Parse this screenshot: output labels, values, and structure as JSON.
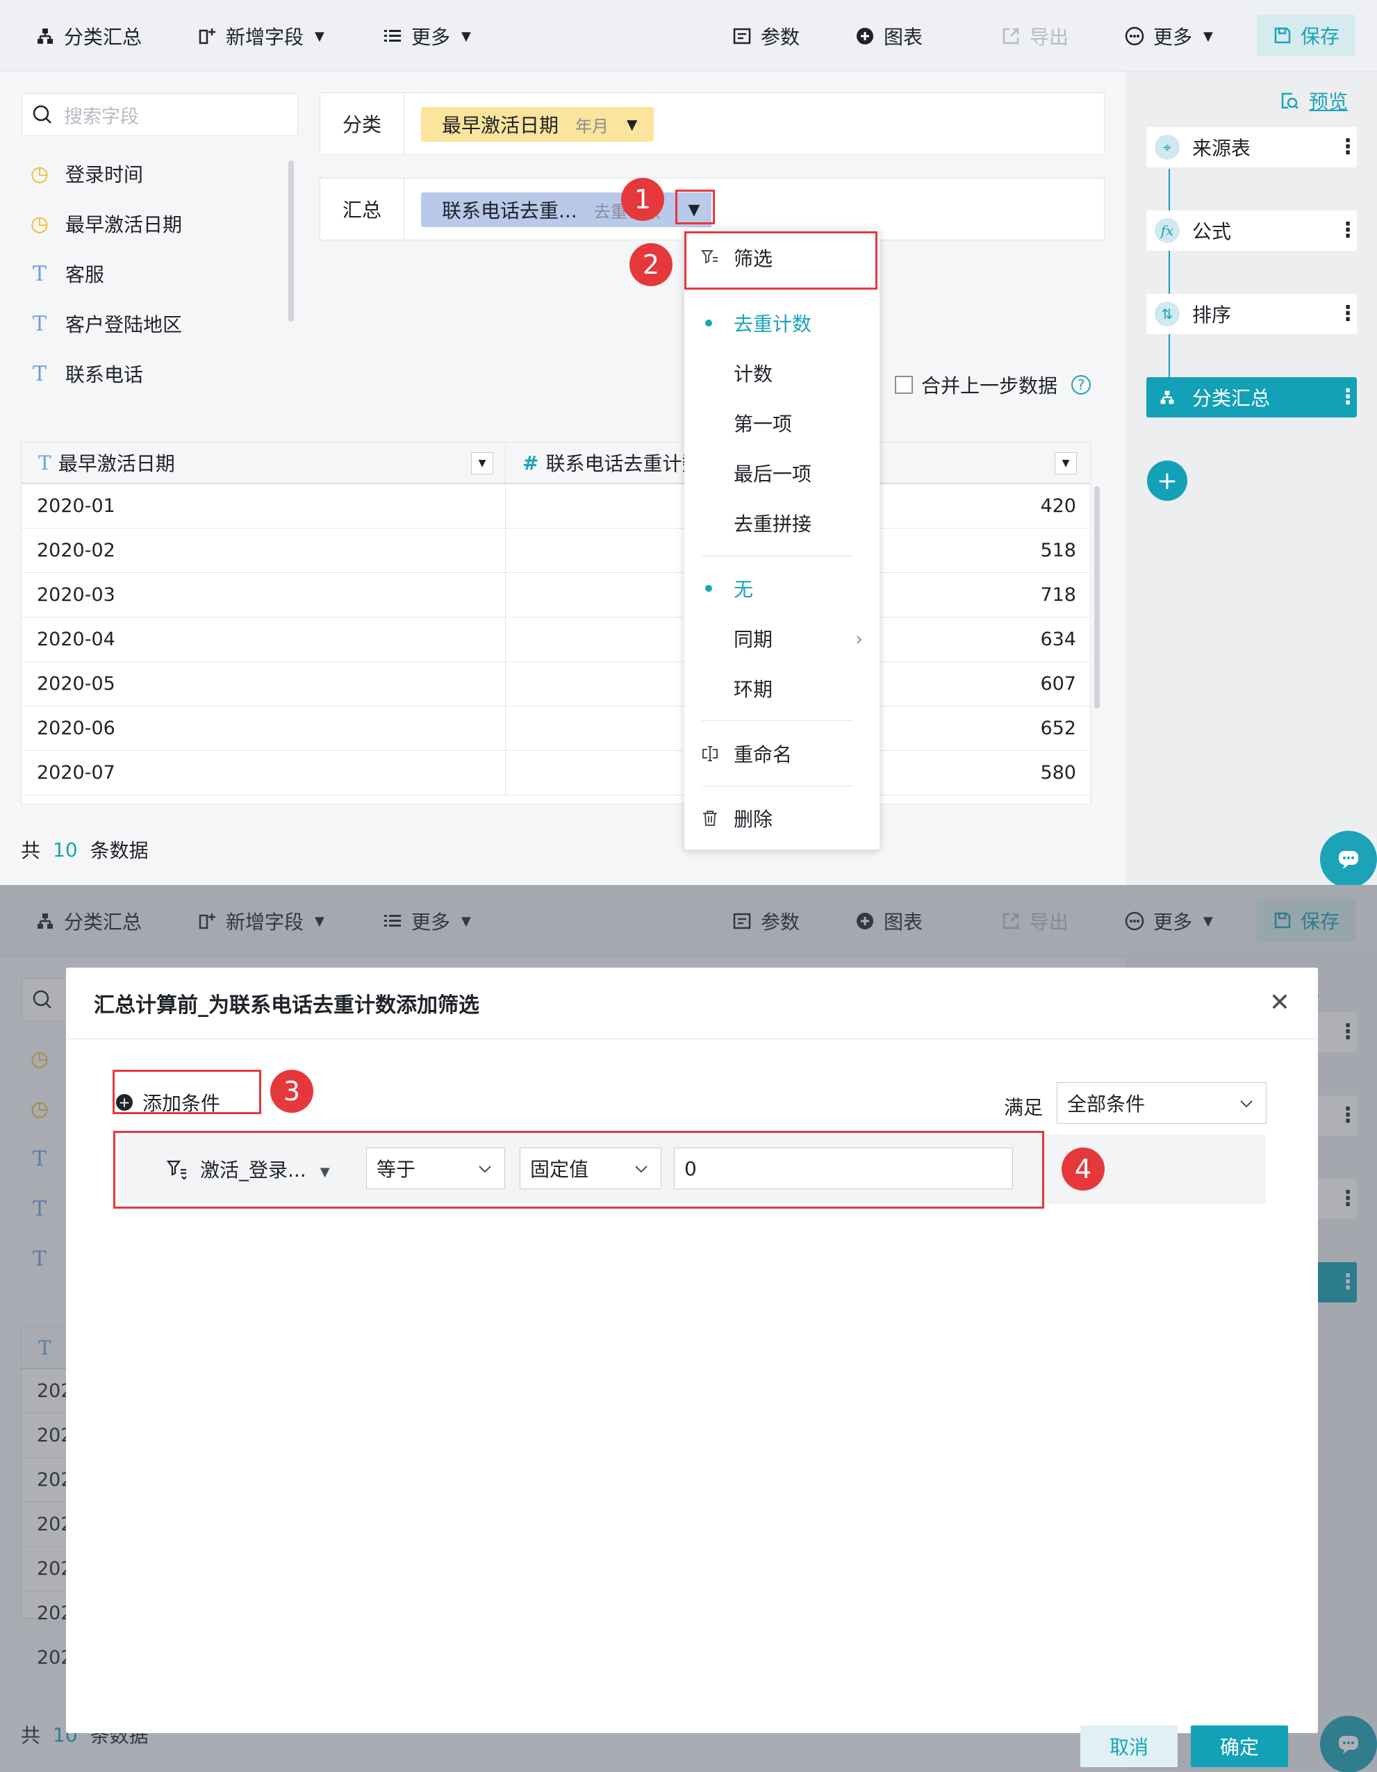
{
  "toolbar": {
    "group_summary": "分类汇总",
    "add_field": "新增字段",
    "more_left": "更多",
    "param": "参数",
    "chart": "图表",
    "export": "导出",
    "more_right": "更多",
    "save": "保存"
  },
  "left_panel": {
    "search_placeholder": "搜索字段",
    "fields": [
      {
        "name": "登录时间",
        "type": "clock-icon"
      },
      {
        "name": "最早激活日期",
        "type": "clock-icon"
      },
      {
        "name": "客服",
        "type": "text-type-icon"
      },
      {
        "name": "客户登陆地区",
        "type": "text-type-icon"
      },
      {
        "name": "联系电话",
        "type": "text-type-icon"
      }
    ]
  },
  "config": {
    "category_label": "分类",
    "category_chip": "最早激活日期",
    "category_sub": "年月",
    "summary_label": "汇总",
    "summary_chip": "联系电话去重...",
    "summary_sub": "去重计数",
    "merge_label": "合并上一步数据"
  },
  "table": {
    "columns": [
      "最早激活日期",
      "联系电话去重计数"
    ],
    "rows": [
      [
        "2020-01",
        "420"
      ],
      [
        "2020-02",
        "518"
      ],
      [
        "2020-03",
        "718"
      ],
      [
        "2020-04",
        "634"
      ],
      [
        "2020-05",
        "607"
      ],
      [
        "2020-06",
        "652"
      ],
      [
        "2020-07",
        "580"
      ]
    ],
    "total_prefix": "共",
    "total_count": "10",
    "total_suffix": "条数据"
  },
  "steps_panel": {
    "preview": "预览",
    "steps": [
      "来源表",
      "公式",
      "排序",
      "分类汇总"
    ]
  },
  "dropdown_menu": {
    "filter": "筛选",
    "agg": [
      "去重计数",
      "计数",
      "第一项",
      "最后一项",
      "去重拼接"
    ],
    "selected_agg": "去重计数",
    "compare": [
      "无",
      "同期",
      "环期"
    ],
    "selected_compare": "无",
    "rename": "重命名",
    "delete": "删除"
  },
  "annotations": [
    "1",
    "2",
    "3",
    "4"
  ],
  "dialog": {
    "title": "汇总计算前_为联系电话去重计数添加筛选",
    "add_condition": "添加条件",
    "satisfy_label": "满足",
    "satisfy_value": "全部条件",
    "condition": {
      "field": "激活_登录...",
      "operator": "等于",
      "value_type": "固定值",
      "value": "0"
    },
    "cancel": "取消",
    "confirm": "确定"
  },
  "colors": {
    "accent": "#1ba3b8",
    "annotation_red": "#e5383b",
    "category_chip": "#fbe49b",
    "summary_chip": "#b9c9ea"
  }
}
